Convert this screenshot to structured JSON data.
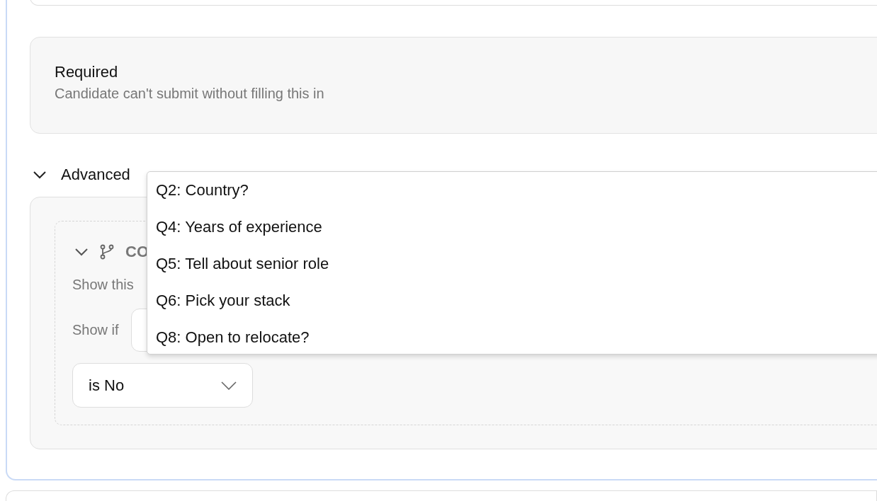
{
  "required": {
    "title": "Required",
    "description": "Candidate can't submit without filling this in"
  },
  "advanced": {
    "label": "Advanced",
    "expanded": true,
    "condition": {
      "heading": "CO",
      "expanded": true,
      "description": "Show this",
      "show_if_label": "Show if",
      "operator": {
        "value": "is No"
      }
    }
  },
  "dropdown": {
    "options": [
      {
        "label": "Q2: Country?",
        "selected": false
      },
      {
        "label": "Q4: Years of experience",
        "selected": false
      },
      {
        "label": "Q5: Tell about senior role",
        "selected": false
      },
      {
        "label": "Q6: Pick your stack",
        "selected": false
      },
      {
        "label": "Q8: Open to relocate?",
        "selected": false
      }
    ]
  }
}
